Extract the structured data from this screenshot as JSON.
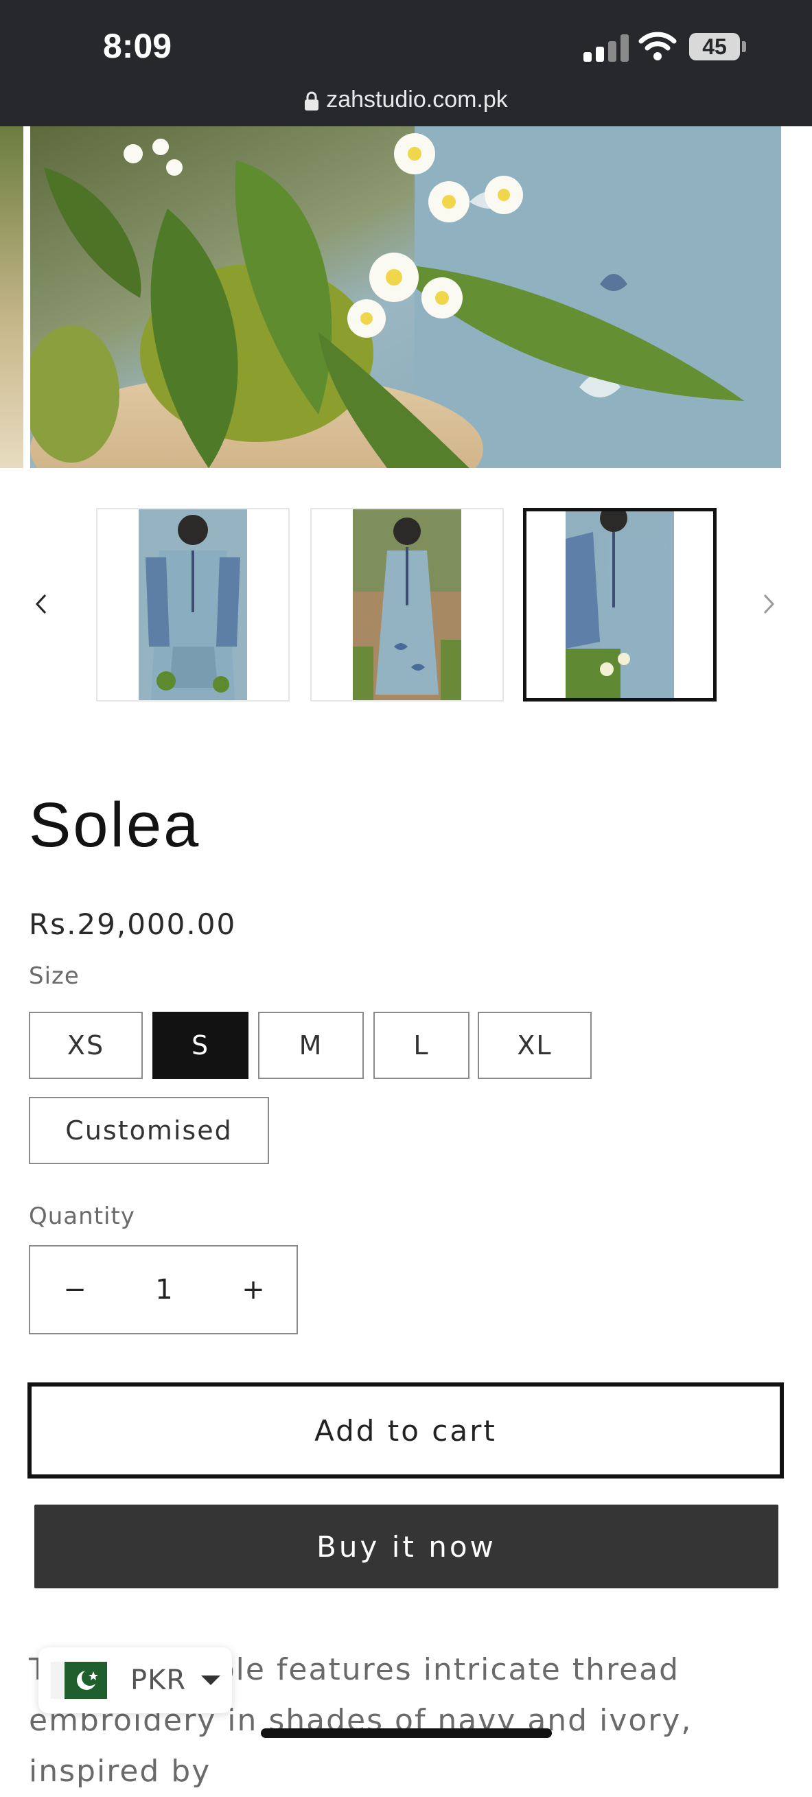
{
  "status_bar": {
    "time": "8:09",
    "battery": "45",
    "icons": [
      "signal-icon",
      "wifi-icon",
      "battery-icon"
    ]
  },
  "browser": {
    "url": "zahstudio.com.pk",
    "lock_icon": "lock-icon"
  },
  "gallery": {
    "prev_icon": "chevron-left-icon",
    "next_icon": "chevron-right-icon",
    "thumbnails": [
      {
        "selected": false
      },
      {
        "selected": false
      },
      {
        "selected": true
      }
    ]
  },
  "product": {
    "title": "Solea",
    "price": "Rs.29,000.00",
    "size_label": "Size",
    "sizes": [
      "XS",
      "S",
      "M",
      "L",
      "XL",
      "Customised"
    ],
    "selected_size": "S",
    "quantity_label": "Quantity",
    "quantity": "1",
    "minus_symbol": "−",
    "plus_symbol": "+",
    "add_to_cart": "Add to cart",
    "buy_now": "Buy it now",
    "description_line1": "This ensemble features intricate thread",
    "description_line2": "embroidery in shades of navy and ivory, inspired by"
  },
  "currency_selector": {
    "currency": "PKR",
    "flag": "pakistan-flag-icon"
  },
  "colors": {
    "dark": "#121212",
    "buy_button": "#353535",
    "topbar": "#26282b",
    "muted_text": "#6a6a6a"
  }
}
